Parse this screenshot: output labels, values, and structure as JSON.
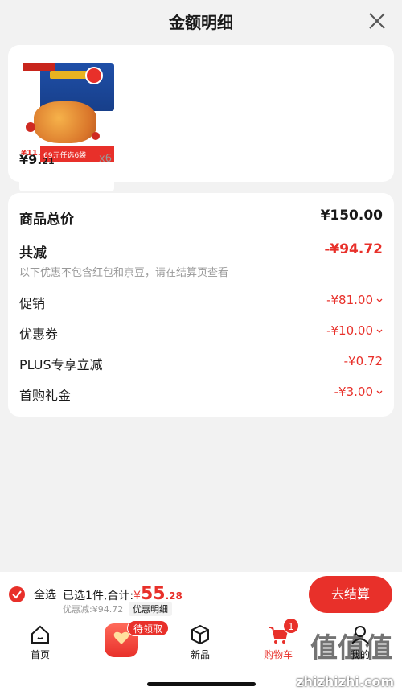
{
  "header": {
    "title": "金额明细"
  },
  "product": {
    "thumb_price": "¥11.5",
    "thumb_promo": "69元任选6袋",
    "price_main": "¥9.",
    "price_cents": "21",
    "quantity": "x6"
  },
  "details": {
    "total_label": "商品总价",
    "total_value": "¥150.00",
    "reduce_label": "共减",
    "reduce_value": "-¥94.72",
    "note": "以下优惠不包含红包和京豆，请在结算页查看",
    "items": [
      {
        "label": "促销",
        "value": "-¥81.00"
      },
      {
        "label": "优惠券",
        "value": "-¥10.00"
      },
      {
        "label": "PLUS专享立减",
        "value": "-¥0.72"
      },
      {
        "label": "首购礼金",
        "value": "-¥3.00"
      }
    ]
  },
  "checkout": {
    "select_all": "全选",
    "selected_text": "已选1件,合计:",
    "currency": "¥",
    "amount_int": "55",
    "amount_dec": ".28",
    "discount_text": "优惠减:¥94.72",
    "detail_link": "优惠明细",
    "button": "去结算"
  },
  "tabbar": {
    "home": "首页",
    "promo_badge": "待领取",
    "new": "新品",
    "cart": "购物车",
    "cart_badge": "1",
    "mine": "我的"
  },
  "watermark": {
    "text": "值值值",
    "url": "zhizhizhi.com"
  },
  "colors": {
    "accent": "#e8302a",
    "background": "#f2f2f2"
  }
}
